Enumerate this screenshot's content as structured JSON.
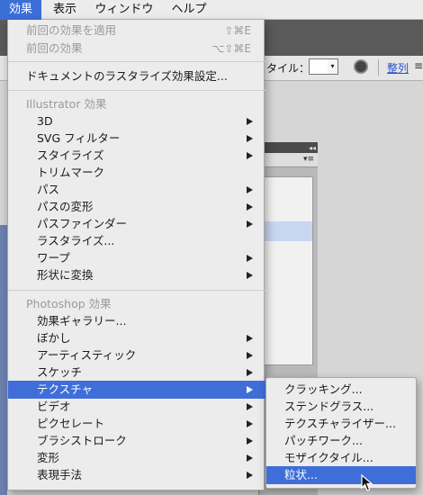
{
  "menubar": {
    "items": [
      "効果",
      "表示",
      "ウィンドウ",
      "ヘルプ"
    ]
  },
  "toolbar": {
    "style_label": "タイル：",
    "align_label": "整列"
  },
  "effect_menu": {
    "apply_last": {
      "label": "前回の効果を適用",
      "shortcut": "⇧⌘E"
    },
    "last_effect": {
      "label": "前回の効果",
      "shortcut": "⌥⇧⌘E"
    },
    "raster_settings": "ドキュメントのラスタライズ効果設定...",
    "illustrator_header": "Illustrator 効果",
    "illustrator_items": [
      "3D",
      "SVG フィルター",
      "スタイライズ",
      "トリムマーク",
      "パス",
      "パスの変形",
      "パスファインダー",
      "ラスタライズ...",
      "ワープ",
      "形状に変換"
    ],
    "photoshop_header": "Photoshop 効果",
    "photoshop_items": [
      "効果ギャラリー...",
      "ぼかし",
      "アーティスティック",
      "スケッチ",
      "テクスチャ",
      "ビデオ",
      "ピクセレート",
      "ブラシストローク",
      "変形",
      "表現手法"
    ],
    "selected": "テクスチャ"
  },
  "texture_submenu": {
    "items": [
      "クラッキング...",
      "ステンドグラス...",
      "テクスチャライザー...",
      "パッチワーク...",
      "モザイクタイル...",
      "粒状..."
    ],
    "selected": "粒状..."
  },
  "colors": {
    "selection": "#3f6ed9",
    "menu_bg": "#ececec"
  }
}
